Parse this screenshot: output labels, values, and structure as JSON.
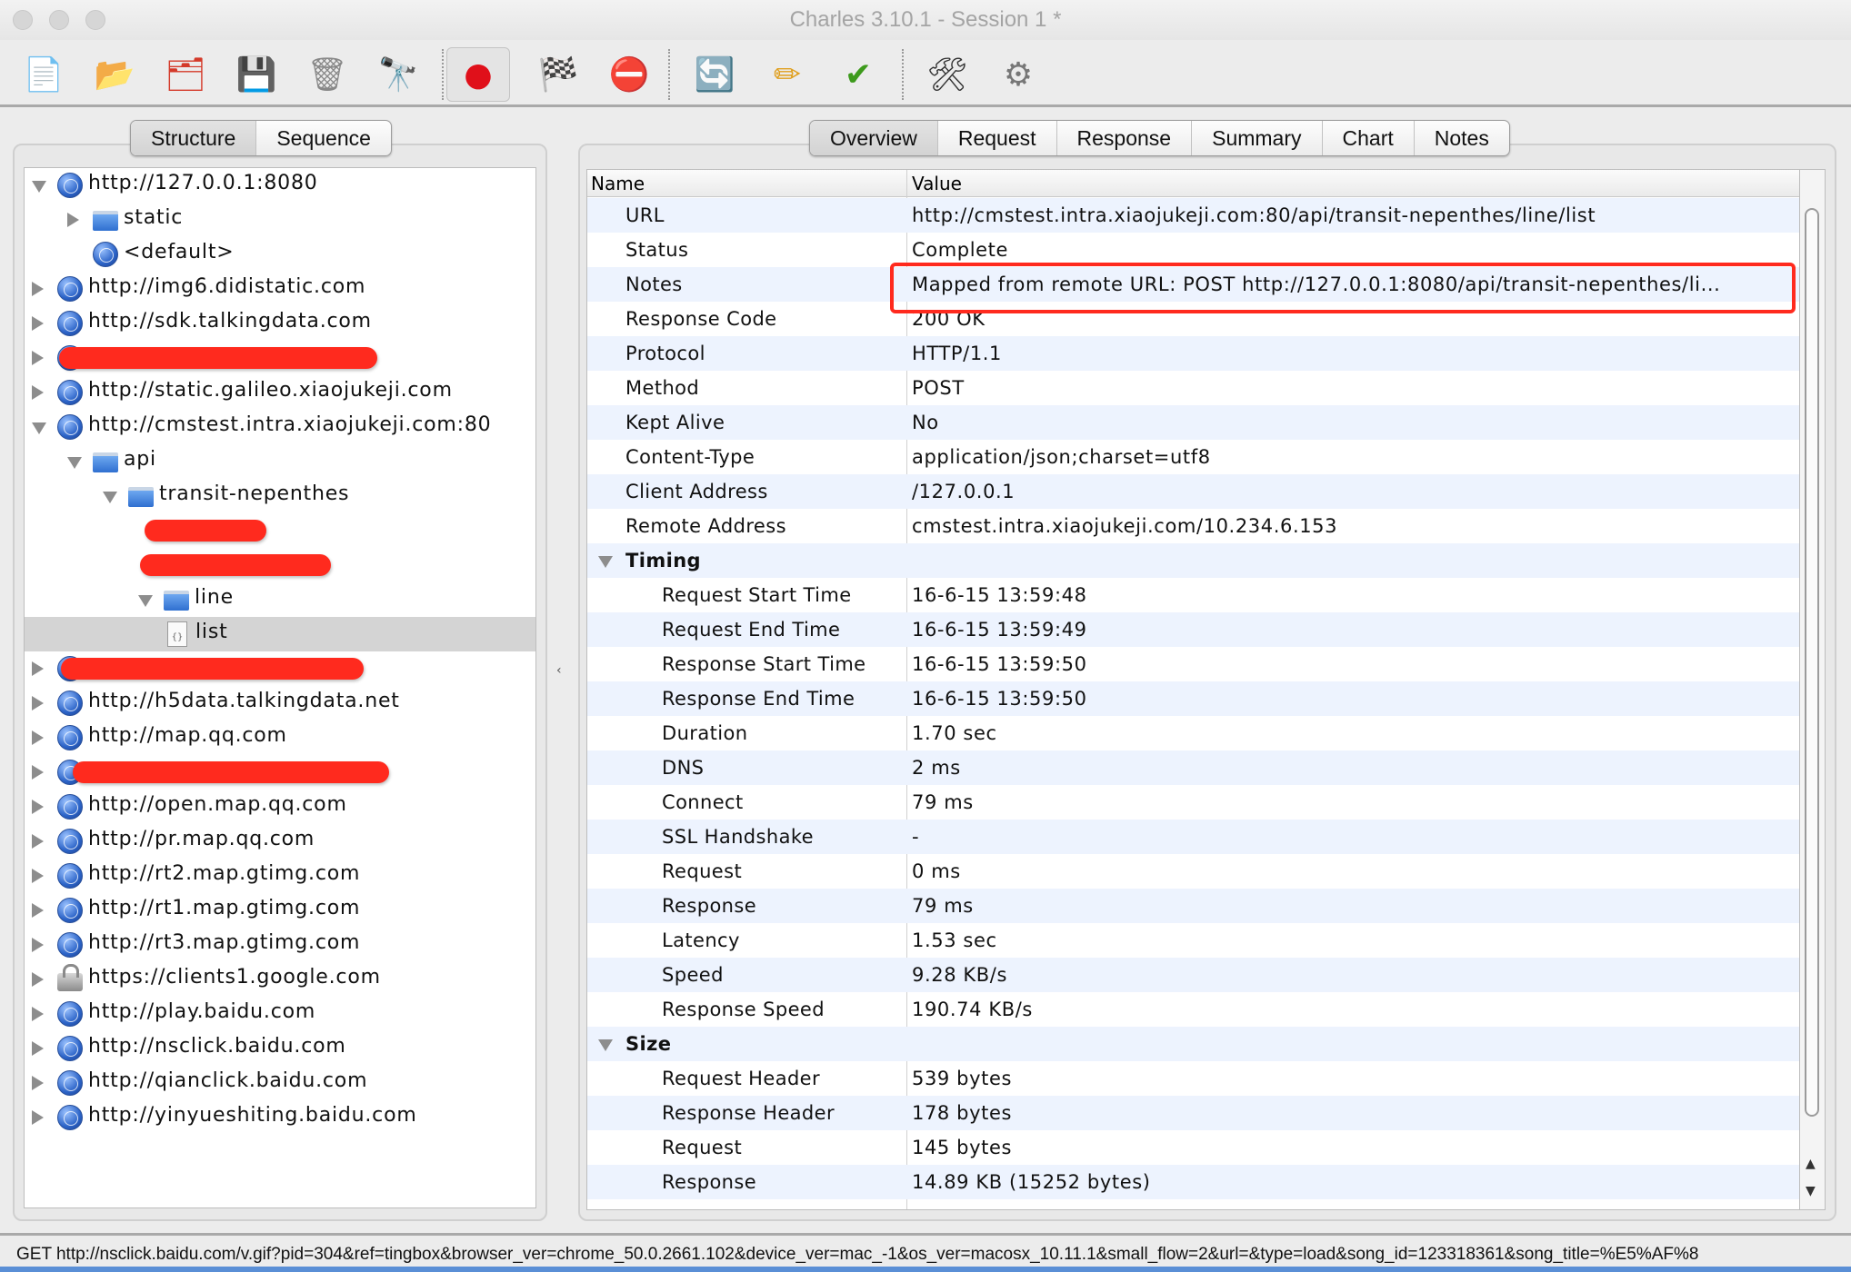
{
  "window": {
    "title": "Charles 3.10.1 - Session 1 *"
  },
  "toolbar": {
    "items": [
      {
        "name": "new-session-icon",
        "glyph": "📄"
      },
      {
        "name": "open-session-icon",
        "glyph": "📂"
      },
      {
        "name": "close-session-icon",
        "glyph": "🗂"
      },
      {
        "name": "save-icon",
        "glyph": "💾"
      },
      {
        "name": "trash-icon",
        "glyph": "🗑"
      },
      {
        "name": "binoculars-icon",
        "glyph": "🔭"
      },
      {
        "name": "record-icon",
        "glyph": "●"
      },
      {
        "name": "checkered-flag-icon",
        "glyph": "🏁"
      },
      {
        "name": "stop-icon",
        "glyph": "⛔"
      },
      {
        "name": "repeat-icon",
        "glyph": "🔄"
      },
      {
        "name": "pencil-icon",
        "glyph": "✏"
      },
      {
        "name": "checkmark-icon",
        "glyph": "✔"
      },
      {
        "name": "tools-icon",
        "glyph": "🛠"
      },
      {
        "name": "gear-icon",
        "glyph": "⚙"
      }
    ]
  },
  "left": {
    "tabs": [
      {
        "label": "Structure",
        "active": true
      },
      {
        "label": "Sequence",
        "active": false
      }
    ],
    "tree": [
      {
        "level": 0,
        "arrow": "expanded",
        "icon": "globe",
        "label": "http://127.0.0.1:8080"
      },
      {
        "level": 1,
        "arrow": "collapsed",
        "icon": "folder",
        "label": "static"
      },
      {
        "level": 1,
        "arrow": "none",
        "icon": "globe",
        "label": "<default>"
      },
      {
        "level": 0,
        "arrow": "collapsed",
        "icon": "globe",
        "label": "http://img6.didistatic.com"
      },
      {
        "level": 0,
        "arrow": "collapsed",
        "icon": "globe",
        "label": "http://sdk.talkingdata.com"
      },
      {
        "level": 0,
        "arrow": "collapsed",
        "icon": "globe",
        "label": "",
        "redacted": true
      },
      {
        "level": 0,
        "arrow": "collapsed",
        "icon": "globe",
        "label": "http://static.galileo.xiaojukeji.com"
      },
      {
        "level": 0,
        "arrow": "expanded",
        "icon": "globe",
        "label": "http://cmstest.intra.xiaojukeji.com:80"
      },
      {
        "level": 1,
        "arrow": "expanded",
        "icon": "folder",
        "label": "api"
      },
      {
        "level": 2,
        "arrow": "expanded",
        "icon": "folder",
        "label": "transit-nepenthes"
      },
      {
        "level": 3,
        "arrow": "none",
        "icon": "none",
        "label": "",
        "redacted": true
      },
      {
        "level": 3,
        "arrow": "none",
        "icon": "none",
        "label": "",
        "redacted": true
      },
      {
        "level": 3,
        "arrow": "expanded",
        "icon": "folder",
        "label": "line"
      },
      {
        "level": 4,
        "arrow": "none",
        "icon": "file",
        "label": "list",
        "selected": true
      },
      {
        "level": 0,
        "arrow": "collapsed",
        "icon": "globe",
        "label": "",
        "redacted": true
      },
      {
        "level": 0,
        "arrow": "collapsed",
        "icon": "globe",
        "label": "http://h5data.talkingdata.net"
      },
      {
        "level": 0,
        "arrow": "collapsed",
        "icon": "globe",
        "label": "http://map.qq.com"
      },
      {
        "level": 0,
        "arrow": "collapsed",
        "icon": "globe",
        "label": "",
        "redacted": true
      },
      {
        "level": 0,
        "arrow": "collapsed",
        "icon": "globe",
        "label": "http://open.map.qq.com"
      },
      {
        "level": 0,
        "arrow": "collapsed",
        "icon": "globe",
        "label": "http://pr.map.qq.com"
      },
      {
        "level": 0,
        "arrow": "collapsed",
        "icon": "globe",
        "label": "http://rt2.map.gtimg.com"
      },
      {
        "level": 0,
        "arrow": "collapsed",
        "icon": "globe",
        "label": "http://rt1.map.gtimg.com"
      },
      {
        "level": 0,
        "arrow": "collapsed",
        "icon": "globe",
        "label": "http://rt3.map.gtimg.com"
      },
      {
        "level": 0,
        "arrow": "collapsed",
        "icon": "lock",
        "label": "https://clients1.google.com"
      },
      {
        "level": 0,
        "arrow": "collapsed",
        "icon": "globe",
        "label": "http://play.baidu.com"
      },
      {
        "level": 0,
        "arrow": "collapsed",
        "icon": "globe",
        "label": "http://nsclick.baidu.com"
      },
      {
        "level": 0,
        "arrow": "collapsed",
        "icon": "globe",
        "label": "http://qianclick.baidu.com"
      },
      {
        "level": 0,
        "arrow": "collapsed",
        "icon": "globe",
        "label": "http://yinyueshiting.baidu.com"
      }
    ]
  },
  "right": {
    "tabs": [
      {
        "label": "Overview",
        "active": true
      },
      {
        "label": "Request",
        "active": false
      },
      {
        "label": "Response",
        "active": false
      },
      {
        "label": "Summary",
        "active": false
      },
      {
        "label": "Chart",
        "active": false
      },
      {
        "label": "Notes",
        "active": false
      }
    ],
    "columns": {
      "name": "Name",
      "value": "Value"
    },
    "rows": [
      {
        "name": "URL",
        "value": "http://cmstest.intra.xiaojukeji.com:80/api/transit-nepenthes/line/list",
        "indent": 1
      },
      {
        "name": "Status",
        "value": "Complete",
        "indent": 1
      },
      {
        "name": "Notes",
        "value": "Mapped from remote URL: POST http://127.0.0.1:8080/api/transit-nepenthes/li...",
        "indent": 1,
        "highlighted": true
      },
      {
        "name": "Response Code",
        "value": "200 OK",
        "indent": 1
      },
      {
        "name": "Protocol",
        "value": "HTTP/1.1",
        "indent": 1
      },
      {
        "name": "Method",
        "value": "POST",
        "indent": 1
      },
      {
        "name": "Kept Alive",
        "value": "No",
        "indent": 1
      },
      {
        "name": "Content-Type",
        "value": "application/json;charset=utf8",
        "indent": 1
      },
      {
        "name": "Client Address",
        "value": "/127.0.0.1",
        "indent": 1
      },
      {
        "name": "Remote Address",
        "value": "cmstest.intra.xiaojukeji.com/10.234.6.153",
        "indent": 1
      },
      {
        "name": "Timing",
        "value": "",
        "section": true
      },
      {
        "name": "Request Start Time",
        "value": "16-6-15 13:59:48",
        "indent": 2
      },
      {
        "name": "Request End Time",
        "value": "16-6-15 13:59:49",
        "indent": 2
      },
      {
        "name": "Response Start Time",
        "value": "16-6-15 13:59:50",
        "indent": 2
      },
      {
        "name": "Response End Time",
        "value": "16-6-15 13:59:50",
        "indent": 2
      },
      {
        "name": "Duration",
        "value": "1.70 sec",
        "indent": 2
      },
      {
        "name": "DNS",
        "value": "2 ms",
        "indent": 2
      },
      {
        "name": "Connect",
        "value": "79 ms",
        "indent": 2
      },
      {
        "name": "SSL Handshake",
        "value": "-",
        "indent": 2
      },
      {
        "name": "Request",
        "value": "0 ms",
        "indent": 2
      },
      {
        "name": "Response",
        "value": "79 ms",
        "indent": 2
      },
      {
        "name": "Latency",
        "value": "1.53 sec",
        "indent": 2
      },
      {
        "name": "Speed",
        "value": "9.28 KB/s",
        "indent": 2
      },
      {
        "name": "Response Speed",
        "value": "190.74 KB/s",
        "indent": 2
      },
      {
        "name": "Size",
        "value": "",
        "section": true
      },
      {
        "name": "Request Header",
        "value": "539 bytes",
        "indent": 2
      },
      {
        "name": "Response Header",
        "value": "178 bytes",
        "indent": 2
      },
      {
        "name": "Request",
        "value": "145 bytes",
        "indent": 2
      },
      {
        "name": "Response",
        "value": "14.89 KB (15252 bytes)",
        "indent": 2
      }
    ]
  },
  "statusbar": {
    "text": "GET http://nsclick.baidu.com/v.gif?pid=304&ref=tingbox&browser_ver=chrome_50.0.2661.102&device_ver=mac_-1&os_ver=macosx_10.11.1&small_flow=2&url=&type=load&song_id=123318361&song_title=%E5%AF%8"
  },
  "colors": {
    "highlight": "#ff2a1e",
    "row_alt": "#edf3fe",
    "selected_row": "#d4d4d4"
  }
}
